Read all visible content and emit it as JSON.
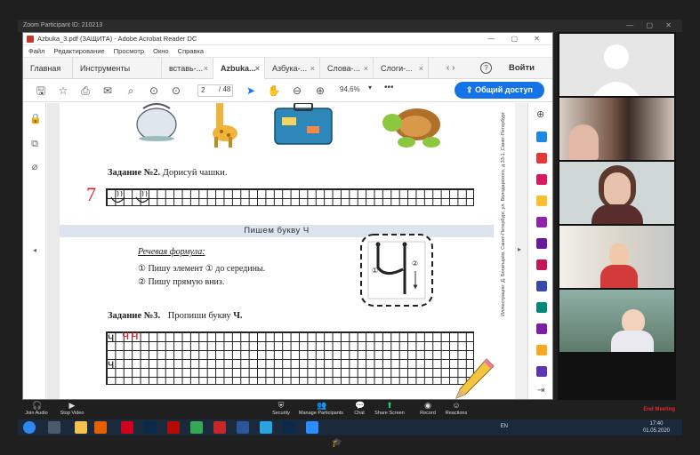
{
  "zoom": {
    "window_title": "Zoom Participant ID: 210213",
    "controls": {
      "join_audio": "Join Audio",
      "stop_video": "Stop Video",
      "security": "Security",
      "participants": "Manage Participants",
      "chat": "Chat",
      "share": "Share Screen",
      "record": "Record",
      "reactions": "Reactions",
      "end": "End Meeting"
    }
  },
  "acrobat": {
    "title": "Azbuka_3.pdf (ЗАЩИТА) - Adobe Acrobat Reader DC",
    "menu": [
      "Файл",
      "Редактирование",
      "Просмотр",
      "Окно",
      "Справка"
    ],
    "tabs": [
      {
        "label": "Главная",
        "close": ""
      },
      {
        "label": "Инструменты",
        "close": ""
      },
      {
        "label": "вставь-...",
        "close": "×"
      },
      {
        "label": "Azbuka...",
        "close": "×"
      },
      {
        "label": "Азбука-...",
        "close": "×"
      },
      {
        "label": "Слова-...",
        "close": "×"
      },
      {
        "label": "Слоги-...",
        "close": "×"
      }
    ],
    "signin": "Войти",
    "page_current": "2",
    "page_total": "/ 48",
    "zoom_level": "94,6%",
    "share_button": "Общий доступ"
  },
  "worksheet": {
    "task2": {
      "label": "Задание №2.",
      "text": "Дорисуй чашки."
    },
    "band_title": "Пишем букву Ч",
    "formula_title": "Речевая формула",
    "formula_lines": [
      "① Пишу элемент ① до середины.",
      "② Пишу прямую вниз."
    ],
    "task3": {
      "label": "Задание №3.",
      "text": "Пропиши букву",
      "letter": "Ч."
    },
    "side_text": "Иллюстрации: Д. Богатырёв. Санкт-Петербург, ул. Володарского, д.33-1. Санкт-Петербург",
    "handwriting_mark": "7",
    "handwriting_letters": "чч"
  },
  "taskbar": {
    "lang": "EN",
    "time": "17:40",
    "date": "01.05.2020"
  }
}
